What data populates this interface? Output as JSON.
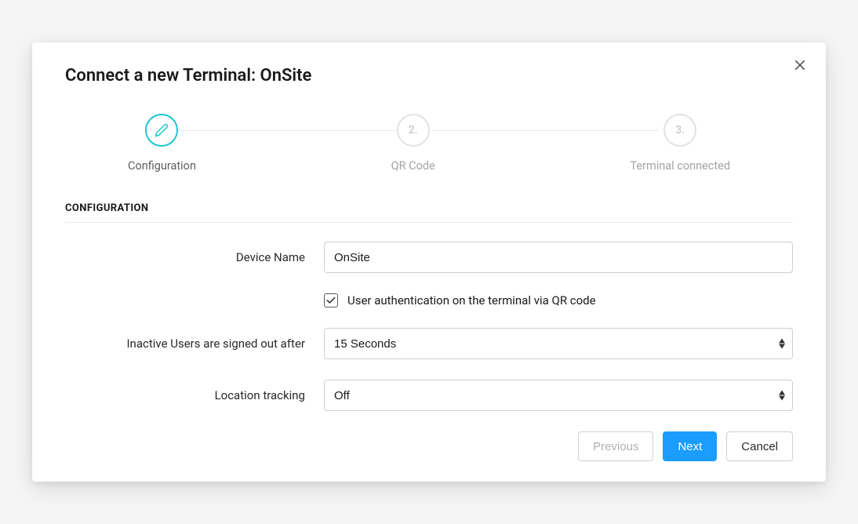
{
  "modal": {
    "title": "Connect a new Terminal: OnSite"
  },
  "steps": [
    {
      "label": "Configuration",
      "active": true
    },
    {
      "label": "QR Code",
      "num": "2."
    },
    {
      "label": "Terminal connected",
      "num": "3."
    }
  ],
  "section": {
    "header": "CONFIGURATION",
    "fields": {
      "deviceName": {
        "label": "Device Name",
        "value": "OnSite"
      },
      "qrAuth": {
        "label": "User authentication on the terminal via QR code",
        "checked": true
      },
      "signOut": {
        "label": "Inactive Users are signed out after",
        "value": "15 Seconds"
      },
      "location": {
        "label": "Location tracking",
        "value": "Off"
      }
    }
  },
  "footer": {
    "previous": "Previous",
    "next": "Next",
    "cancel": "Cancel"
  }
}
